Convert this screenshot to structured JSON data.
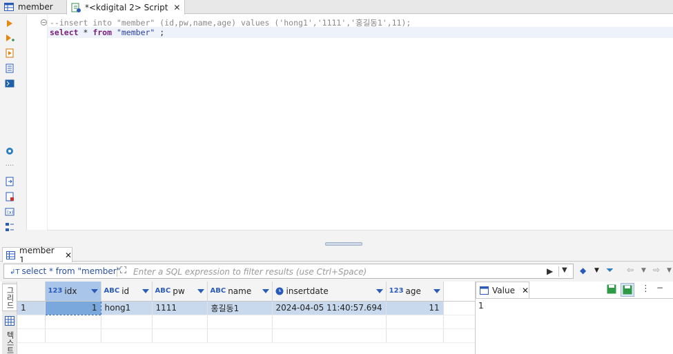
{
  "tabs": [
    {
      "label": "member",
      "active": false
    },
    {
      "label": "*<kdigital 2> Script",
      "active": true
    }
  ],
  "editor": {
    "lines": [
      {
        "kind": "comment",
        "text": "--insert into \"member\" (id,pw,name,age) values ('hong1','1111','홍길동1',11);"
      },
      {
        "kind": "sql",
        "kw1": "select",
        "mid": " * ",
        "kw2": "from",
        "str": " \"member\"",
        "tail": " ;"
      }
    ]
  },
  "results": {
    "tab_label": "member 1",
    "filter_query": "select * from \"member\"",
    "filter_placeholder": "Enter a SQL expression to filter results (use Ctrl+Space)",
    "side_tabs": [
      "그리드",
      "텍스트"
    ],
    "columns": [
      {
        "type": "123",
        "name": "idx"
      },
      {
        "type": "ABC",
        "name": "id"
      },
      {
        "type": "ABC",
        "name": "pw"
      },
      {
        "type": "ABC",
        "name": "name"
      },
      {
        "type": "clock",
        "name": "insertdate"
      },
      {
        "type": "123",
        "name": "age"
      }
    ],
    "rows": [
      {
        "num": "1",
        "cells": [
          "1",
          "hong1",
          "1111",
          "홍길동1",
          "2024-04-05 11:40:57.694",
          "11"
        ]
      }
    ]
  },
  "value_panel": {
    "tab_label": "Value",
    "value": "1"
  },
  "colors": {
    "selected_row": "#c8d9ee",
    "focused_cell": "#7aa7dc",
    "keyword": "#7a1f7a",
    "string": "#2c3ea8"
  }
}
